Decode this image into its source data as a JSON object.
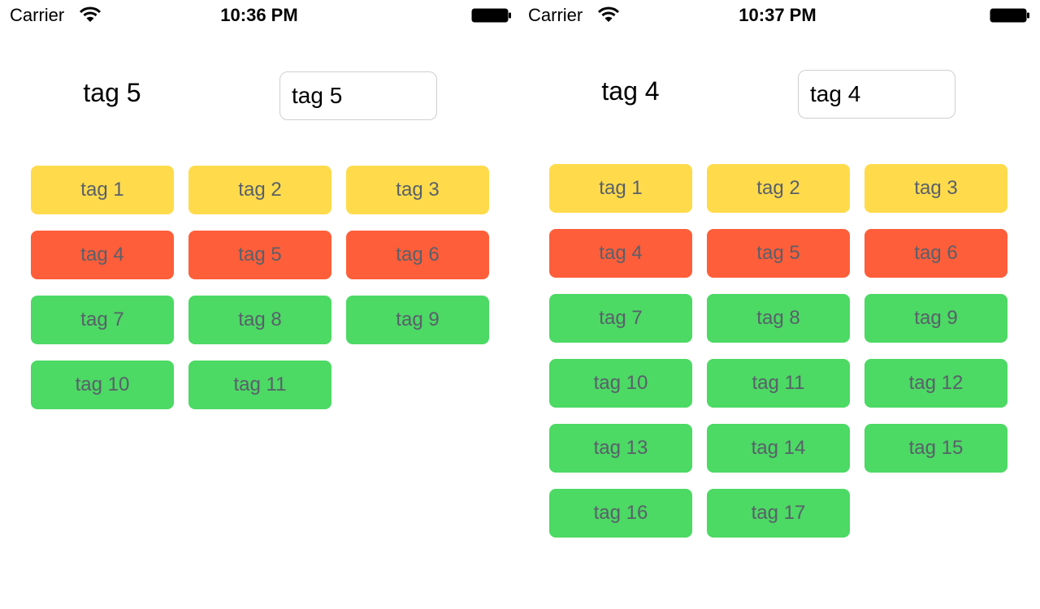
{
  "colors": {
    "yellow": "#ffdb4c",
    "red": "#ff5e3a",
    "green": "#4cd964",
    "tag_text": "#59606a"
  },
  "left_screen": {
    "status_bar": {
      "carrier": "Carrier",
      "time": "10:36 PM",
      "icons": [
        "wifi-icon",
        "battery-icon"
      ]
    },
    "selected_label": "tag 5",
    "input_value": "tag 5",
    "tags": [
      {
        "label": "tag 1",
        "color": "yellow"
      },
      {
        "label": "tag 2",
        "color": "yellow"
      },
      {
        "label": "tag 3",
        "color": "yellow"
      },
      {
        "label": "tag 4",
        "color": "red"
      },
      {
        "label": "tag 5",
        "color": "red"
      },
      {
        "label": "tag 6",
        "color": "red"
      },
      {
        "label": "tag 7",
        "color": "green"
      },
      {
        "label": "tag 8",
        "color": "green"
      },
      {
        "label": "tag 9",
        "color": "green"
      },
      {
        "label": "tag 10",
        "color": "green"
      },
      {
        "label": "tag 11",
        "color": "green"
      }
    ]
  },
  "right_screen": {
    "status_bar": {
      "carrier": "Carrier",
      "time": "10:37 PM",
      "icons": [
        "wifi-icon",
        "battery-icon"
      ]
    },
    "selected_label": "tag 4",
    "input_value": "tag 4",
    "tags": [
      {
        "label": "tag 1",
        "color": "yellow"
      },
      {
        "label": "tag 2",
        "color": "yellow"
      },
      {
        "label": "tag 3",
        "color": "yellow"
      },
      {
        "label": "tag 4",
        "color": "red"
      },
      {
        "label": "tag 5",
        "color": "red"
      },
      {
        "label": "tag 6",
        "color": "red"
      },
      {
        "label": "tag 7",
        "color": "green"
      },
      {
        "label": "tag 8",
        "color": "green"
      },
      {
        "label": "tag 9",
        "color": "green"
      },
      {
        "label": "tag 10",
        "color": "green"
      },
      {
        "label": "tag 11",
        "color": "green"
      },
      {
        "label": "tag 12",
        "color": "green"
      },
      {
        "label": "tag 13",
        "color": "green"
      },
      {
        "label": "tag 14",
        "color": "green"
      },
      {
        "label": "tag 15",
        "color": "green"
      },
      {
        "label": "tag 16",
        "color": "green"
      },
      {
        "label": "tag 17",
        "color": "green"
      }
    ]
  }
}
